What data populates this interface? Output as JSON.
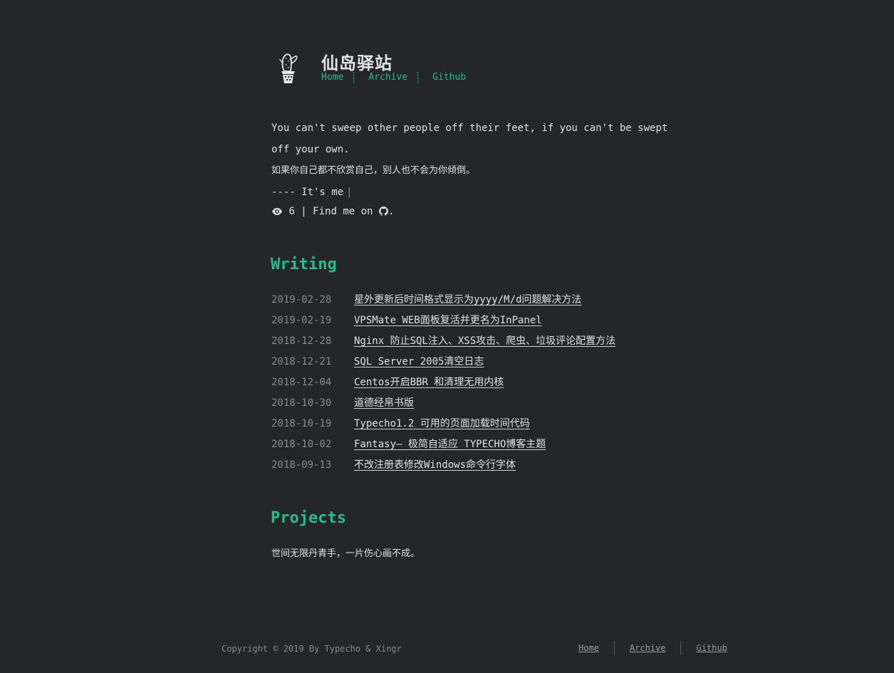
{
  "header": {
    "site_title": "仙岛驿站",
    "nav": [
      "Home",
      "Archive",
      "Github"
    ]
  },
  "intro": {
    "quote_en": "You can't sweep other people off their feet, if you can't be swept off your own.",
    "quote_zh": "如果你自己都不欣赏自己，别人也不会为你倾倒。",
    "signature": "---- It's me",
    "views": "6",
    "find_me": "Find me on"
  },
  "writing": {
    "title": "Writing",
    "posts": [
      {
        "date": "2019-02-28",
        "title": "星外更新后时间格式显示为yyyy/M/d问题解决方法"
      },
      {
        "date": "2019-02-19",
        "title": "VPSMate WEB面板复活并更名为InPanel"
      },
      {
        "date": "2018-12-28",
        "title": "Nginx 防止SQL注入、XSS攻击、爬虫、垃圾评论配置方法"
      },
      {
        "date": "2018-12-21",
        "title": "SQL Server 2005清空日志"
      },
      {
        "date": "2018-12-04",
        "title": "Centos开启BBR 和清理无用内核"
      },
      {
        "date": "2018-10-30",
        "title": "道德经帛书版"
      },
      {
        "date": "2018-10-19",
        "title": "Typecho1.2 可用的页面加载时间代码"
      },
      {
        "date": "2018-10-02",
        "title": "Fantasy— 极简自适应 TYPECHO博客主题"
      },
      {
        "date": "2018-09-13",
        "title": "不改注册表修改Windows命令行字体"
      }
    ]
  },
  "projects": {
    "title": "Projects",
    "text": "世间无限丹青手，一片伤心画不成。"
  },
  "footer": {
    "copyright": "Copyright © 2019 By Typecho & Xingr",
    "nav": [
      "Home",
      "Archive",
      "Github"
    ]
  },
  "colors": {
    "background": "#252628",
    "accent": "#2bbc8a",
    "text": "#e0e0e0",
    "muted": "#8a8a8a"
  },
  "icons": [
    "cactus-logo-icon",
    "eye-icon",
    "github-icon"
  ]
}
